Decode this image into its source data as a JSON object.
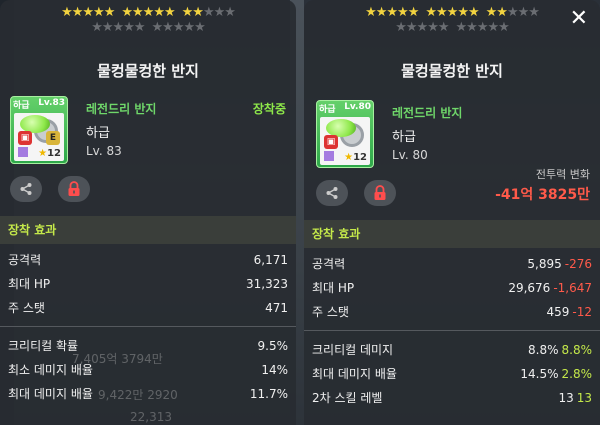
{
  "left": {
    "stars_row1": [
      "on",
      "on",
      "on",
      "on",
      "on",
      "gap",
      "on",
      "on",
      "on",
      "on",
      "on",
      "gap",
      "on",
      "on",
      "off",
      "off",
      "off"
    ],
    "stars_row2": [
      "off",
      "off",
      "off",
      "off",
      "off",
      "gap",
      "off",
      "off",
      "off",
      "off",
      "off"
    ],
    "title": "물컹물컹한 반지",
    "icon": {
      "grade": "하급",
      "level": "Lv.83",
      "lock": "🔒",
      "equip_badge": "E",
      "star_count": "12"
    },
    "name": "레전드리 반지",
    "grade": "하급",
    "level": "Lv. 83",
    "equip_status": "장착중",
    "section": "장착 효과",
    "stats": [
      {
        "label": "공격력",
        "value": "6,171"
      },
      {
        "label": "최대 HP",
        "value": "31,323"
      },
      {
        "label": "주 스탯",
        "value": "471"
      }
    ],
    "sub_stats": [
      {
        "label": "크리티컬 확률",
        "value": "9.5%"
      },
      {
        "label": "최소 데미지 배율",
        "value": "14%"
      },
      {
        "label": "최대 데미지 배율",
        "value": "11.7%"
      }
    ],
    "background_text": [
      "7,405억 3794만",
      "9,422만 2920",
      "22,313"
    ]
  },
  "right": {
    "stars_row1": [
      "on",
      "on",
      "on",
      "on",
      "on",
      "gap",
      "on",
      "on",
      "on",
      "on",
      "on",
      "gap",
      "on",
      "on",
      "off",
      "off",
      "off"
    ],
    "stars_row2": [
      "off",
      "off",
      "off",
      "off",
      "off",
      "gap",
      "off",
      "off",
      "off",
      "off",
      "off"
    ],
    "title": "물컹물컹한 반지",
    "icon": {
      "grade": "하급",
      "level": "Lv.80",
      "lock": "🔒",
      "star_count": "12"
    },
    "name": "레전드리 반지",
    "grade": "하급",
    "level": "Lv. 80",
    "power_label": "전투력 변화",
    "power_value": "-41억 3825만",
    "section": "장착 효과",
    "stats": [
      {
        "label": "공격력",
        "value": "5,895",
        "diff": "-276",
        "diff_type": "down"
      },
      {
        "label": "최대 HP",
        "value": "29,676",
        "diff": "-1,647",
        "diff_type": "down"
      },
      {
        "label": "주 스탯",
        "value": "459",
        "diff": "-12",
        "diff_type": "down"
      }
    ],
    "sub_stats": [
      {
        "label": "크리티컬 데미지",
        "value": "8.8%",
        "diff": "8.8%",
        "diff_type": "up"
      },
      {
        "label": "최대 데미지 배율",
        "value": "14.5%",
        "diff": "2.8%",
        "diff_type": "up"
      },
      {
        "label": "2차 스킬 레벨",
        "value": "13",
        "diff": "13",
        "diff_type": "up"
      }
    ]
  },
  "close_icon": "close-icon",
  "colors": {
    "accent_green": "#c4e84a",
    "decrease_red": "#ff5a4a",
    "name_green": "#6fd76a",
    "star_gold": "#f2d340"
  }
}
